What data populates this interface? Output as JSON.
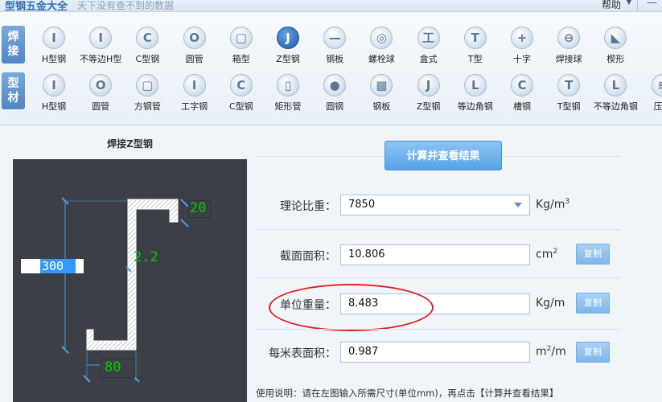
{
  "window": {
    "title": "型钢五金大全",
    "slogan": "天下没有查不到的数据",
    "help_label": "帮助",
    "help_caret": "▼",
    "minimize": "—"
  },
  "toolbar": {
    "weld_tag": [
      "焊",
      "接"
    ],
    "profile_tag": [
      "型",
      "材"
    ],
    "weld_tools": [
      {
        "label": "H型钢",
        "icon": "h-beam-icon",
        "glyph": "I"
      },
      {
        "label": "不等边H型",
        "icon": "unequal-h-beam-icon",
        "glyph": "I"
      },
      {
        "label": "C型钢",
        "icon": "c-channel-icon",
        "glyph": "C"
      },
      {
        "label": "圆管",
        "icon": "round-tube-icon",
        "glyph": "O"
      },
      {
        "label": "箱型",
        "icon": "box-section-icon",
        "glyph": "▢"
      },
      {
        "label": "Z型钢",
        "icon": "z-section-icon",
        "glyph": "J"
      },
      {
        "label": "钢板",
        "icon": "steel-plate-icon",
        "glyph": "—"
      },
      {
        "label": "螺栓球",
        "icon": "bolt-ball-icon",
        "glyph": "◎"
      },
      {
        "label": "盒式",
        "icon": "box-type-icon",
        "glyph": "工"
      },
      {
        "label": "T型",
        "icon": "t-section-icon",
        "glyph": "T"
      },
      {
        "label": "十字",
        "icon": "cross-section-icon",
        "glyph": "+"
      },
      {
        "label": "焊接球",
        "icon": "welded-ball-icon",
        "glyph": "⊖"
      },
      {
        "label": "楔形",
        "icon": "wedge-icon",
        "glyph": "◣"
      }
    ],
    "profile_tools": [
      {
        "label": "H型钢",
        "icon": "h-beam-icon",
        "glyph": "I"
      },
      {
        "label": "圆管",
        "icon": "round-tube-icon",
        "glyph": "O"
      },
      {
        "label": "方钢管",
        "icon": "square-tube-icon",
        "glyph": "▢"
      },
      {
        "label": "工字钢",
        "icon": "i-beam-icon",
        "glyph": "I"
      },
      {
        "label": "C型钢",
        "icon": "c-channel-icon",
        "glyph": "C"
      },
      {
        "label": "矩形管",
        "icon": "rect-tube-icon",
        "glyph": "▯"
      },
      {
        "label": "圆钢",
        "icon": "round-bar-icon",
        "glyph": "●"
      },
      {
        "label": "钢板",
        "icon": "steel-plate-icon",
        "glyph": "▩"
      },
      {
        "label": "Z型钢",
        "icon": "z-section-icon",
        "glyph": "J"
      },
      {
        "label": "等边角钢",
        "icon": "equal-angle-icon",
        "glyph": "L"
      },
      {
        "label": "槽钢",
        "icon": "channel-icon",
        "glyph": "C"
      },
      {
        "label": "T型钢",
        "icon": "t-section-icon",
        "glyph": "T"
      },
      {
        "label": "不等边角钢",
        "icon": "unequal-angle-icon",
        "glyph": "L"
      },
      {
        "label": "压型",
        "icon": "profiled-sheet-icon",
        "glyph": "≋"
      }
    ],
    "active_index": 5
  },
  "diagram": {
    "title": "焊接Z型钢",
    "height_value": "300",
    "flange_lip": "20",
    "thickness": "2.2",
    "flange_width": "80"
  },
  "calc": {
    "button_label": "计算并查看结果",
    "density_label": "理论比重：",
    "density_value": "7850",
    "density_unit": "Kg/m",
    "density_unit_sup": "3",
    "area_label": "截面面积：",
    "area_value": "10.806",
    "area_unit": "cm",
    "area_unit_sup": "2",
    "weight_label": "单位重量：",
    "weight_value": "8.483",
    "weight_unit": "Kg/m",
    "surface_label": "每米表面积：",
    "surface_value": "0.987",
    "surface_unit": "m",
    "surface_unit_sup": "2",
    "surface_unit_tail": "/m",
    "copy_label": "复制",
    "usage": "使用说明：请在左图输入所需尺寸(单位mm)，再点击【计算并查看结果】"
  },
  "colors": {
    "accent": "#5aa3e6",
    "highlight": "#e02020",
    "dimension_text": "#00d000"
  }
}
